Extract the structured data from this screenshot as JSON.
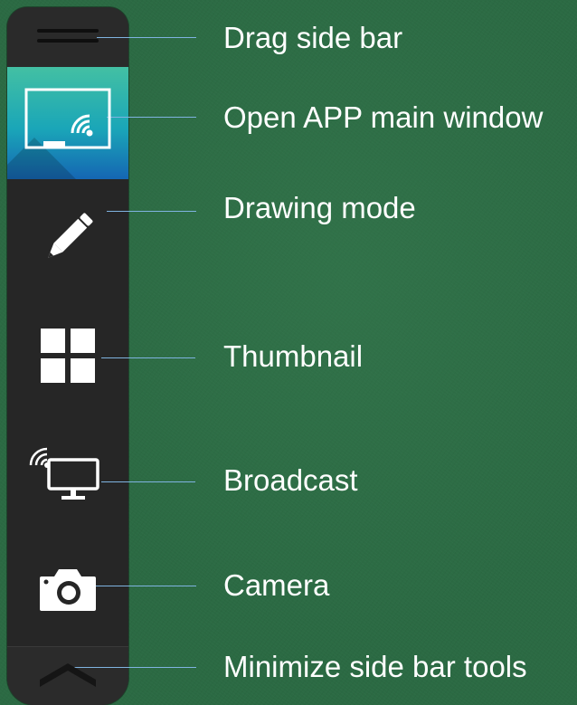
{
  "sidebar": {
    "items": [
      {
        "id": "drag",
        "label": "Drag side bar",
        "icon": "drag-handle-icon"
      },
      {
        "id": "app",
        "label": "Open APP main window",
        "icon": "whiteboard-cast-icon",
        "active": true
      },
      {
        "id": "draw",
        "label": "Drawing mode",
        "icon": "pencil-icon"
      },
      {
        "id": "thumb",
        "label": "Thumbnail",
        "icon": "grid-icon"
      },
      {
        "id": "broadcast",
        "label": "Broadcast",
        "icon": "broadcast-monitor-icon"
      },
      {
        "id": "camera",
        "label": "Camera",
        "icon": "camera-icon"
      },
      {
        "id": "min",
        "label": "Minimize side bar tools",
        "icon": "chevron-up-icon"
      }
    ]
  },
  "colors": {
    "background": "#2b6a43",
    "sidebar": "#262626",
    "active_gradient_top": "#43c0a3",
    "active_gradient_bottom": "#1566b3",
    "connector": "#7fb3e0",
    "label_text": "#ffffff"
  }
}
